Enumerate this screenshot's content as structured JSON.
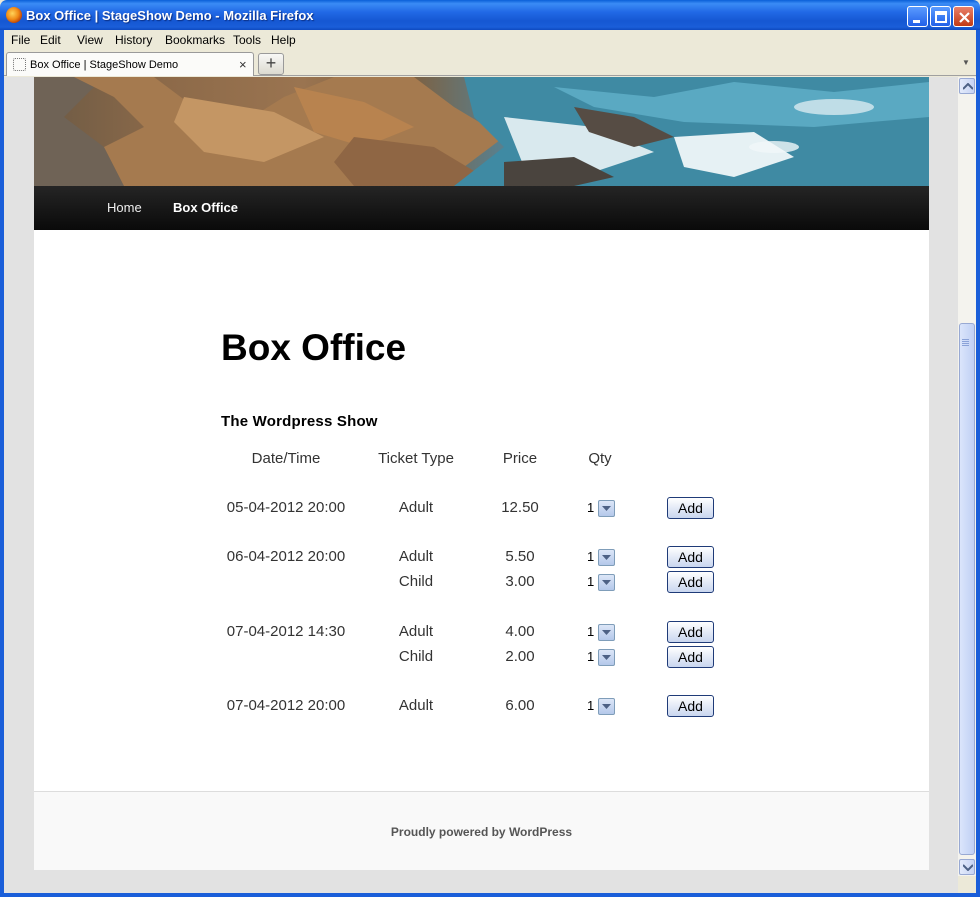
{
  "window": {
    "title": "Box Office  |  StageShow Demo - Mozilla Firefox"
  },
  "menu": [
    "File",
    "Edit",
    "View",
    "History",
    "Bookmarks",
    "Tools",
    "Help"
  ],
  "tab": {
    "label": "Box Office | StageShow Demo",
    "close": "×",
    "new_tab": "+"
  },
  "nav": {
    "home": "Home",
    "box_office": "Box Office"
  },
  "page": {
    "title": "Box Office",
    "show_name": "The Wordpress Show"
  },
  "table": {
    "headers": [
      "Date/Time",
      "Ticket Type",
      "Price",
      "Qty"
    ],
    "rows": [
      {
        "datetime": "05-04-2012 20:00",
        "type": "Adult",
        "price": "12.50",
        "qty": "1",
        "button": "Add"
      },
      {
        "datetime": "06-04-2012 20:00",
        "type": "Adult",
        "price": "5.50",
        "qty": "1",
        "button": "Add"
      },
      {
        "datetime": "",
        "type": "Child",
        "price": "3.00",
        "qty": "1",
        "button": "Add"
      },
      {
        "datetime": "07-04-2012 14:30",
        "type": "Adult",
        "price": "4.00",
        "qty": "1",
        "button": "Add"
      },
      {
        "datetime": "",
        "type": "Child",
        "price": "2.00",
        "qty": "1",
        "button": "Add"
      },
      {
        "datetime": "07-04-2012 20:00",
        "type": "Adult",
        "price": "6.00",
        "qty": "1",
        "button": "Add"
      }
    ]
  },
  "footer": {
    "text": "Proudly powered by WordPress"
  },
  "icons": {
    "app": "firefox-icon",
    "tab": "page-favicon-icon",
    "minimize": "minimize-icon",
    "maximize": "maximize-icon",
    "close": "close-icon",
    "select": "chevron-down-icon"
  },
  "colors": {
    "titlebar": "#1557d2",
    "navbar": "#111111",
    "add_button_border": "#1f3b78"
  }
}
